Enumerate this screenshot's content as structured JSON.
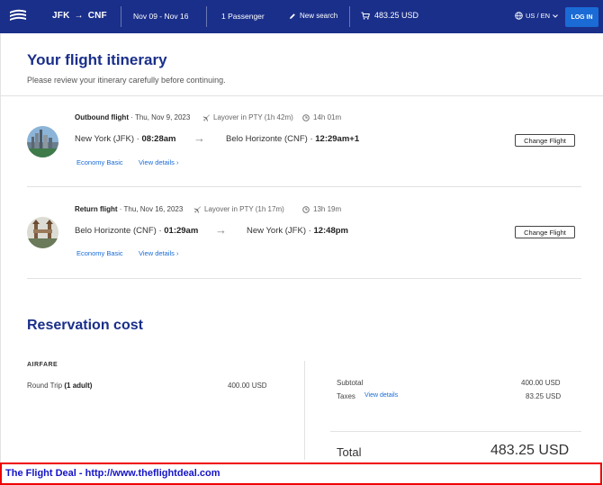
{
  "header": {
    "origin": "JFK",
    "arrow": "→",
    "destination": "CNF",
    "dates": "Nov 09 - Nov 16",
    "passengers": "1 Passenger",
    "new_search": "New search",
    "cart_total": "483.25 USD",
    "locale": "US / EN",
    "login": "LOG IN"
  },
  "itinerary": {
    "title": "Your flight itinerary",
    "subtitle": "Please review your itinerary carefully before continuing.",
    "flights": [
      {
        "label": "Outbound flight",
        "date": " · Thu, Nov 9, 2023",
        "layover": "Layover in PTY (1h 42m)",
        "duration": "14h 01m",
        "from_city": "New York (JFK) · ",
        "from_time": "08:28am",
        "to_city": "Belo Horizonte (CNF) · ",
        "to_time": "12:29am+1",
        "fare": "Economy Basic",
        "details": "View details",
        "change": "Change Flight"
      },
      {
        "label": "Return flight",
        "date": " · Thu, Nov 16, 2023",
        "layover": "Layover in PTY (1h 17m)",
        "duration": "13h 19m",
        "from_city": "Belo Horizonte (CNF) · ",
        "from_time": "01:29am",
        "to_city": "New York (JFK) · ",
        "to_time": "12:48pm",
        "fare": "Economy Basic",
        "details": "View details",
        "change": "Change Flight"
      }
    ]
  },
  "cost": {
    "title": "Reservation cost",
    "airfare_label": "AIRFARE",
    "trip_label": "Round Trip ",
    "trip_pax": "(1 adult)",
    "trip_value": "400.00 USD",
    "subtotal_label": "Subtotal",
    "subtotal_value": "400.00 USD",
    "taxes_label": "Taxes",
    "taxes_link": "View details",
    "taxes_value": "83.25 USD",
    "total_label": "Total",
    "total_value": "483.25 USD"
  },
  "watermark": "The Flight Deal - http://www.theflightdeal.com",
  "colors": {
    "brand": "#1a2f8a",
    "link": "#1a6bd6",
    "watermark_border": "#ee0000"
  }
}
